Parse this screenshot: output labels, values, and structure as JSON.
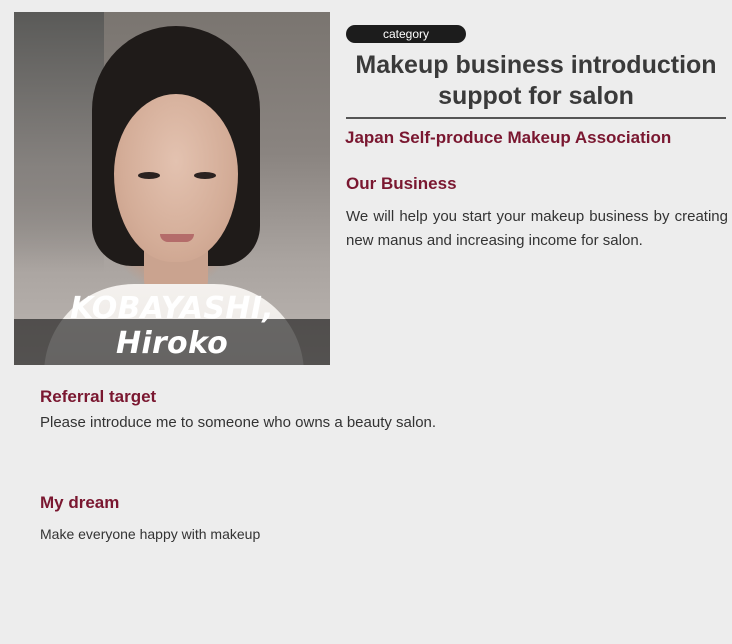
{
  "profile": {
    "name": "KOBAYASHI, Hiroko",
    "photo_icon": "portrait-photo"
  },
  "category": {
    "label": "category",
    "title": "Makeup business introduction suppot for salon"
  },
  "organization": "Japan Self-produce Makeup Association",
  "business": {
    "heading": "Our Business",
    "text": "We will help you start your makeup business by creating new manus and increasing income for salon."
  },
  "referral": {
    "heading": "Referral target",
    "text": "Please introduce me to someone who owns a beauty salon."
  },
  "dream": {
    "heading": "My dream",
    "text": "Make everyone happy with makeup"
  },
  "colors": {
    "accent": "#7a1730",
    "background": "#ededed",
    "pill": "#1c1c1c"
  }
}
